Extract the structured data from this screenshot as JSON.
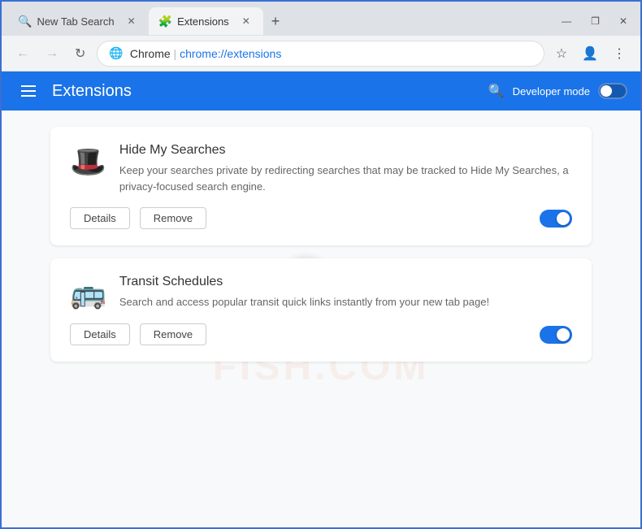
{
  "browser": {
    "tabs": [
      {
        "id": "tab-search",
        "label": "New Tab Search",
        "icon": "🔍",
        "active": false
      },
      {
        "id": "tab-extensions",
        "label": "Extensions",
        "icon": "🧩",
        "active": true
      }
    ],
    "nav": {
      "back_disabled": true,
      "forward_disabled": true
    },
    "address": {
      "brand": "Chrome",
      "url": "chrome://extensions"
    },
    "window_controls": {
      "minimize": "—",
      "maximize": "❐",
      "close": "✕"
    }
  },
  "header": {
    "menu_icon": "☰",
    "title": "Extensions",
    "search_icon": "🔍",
    "developer_mode_label": "Developer mode",
    "developer_mode_on": false
  },
  "extensions": [
    {
      "id": "hide-my-searches",
      "icon": "🎩",
      "name": "Hide My Searches",
      "description": "Keep your searches private by redirecting searches that may be tracked to Hide My Searches, a privacy-focused search engine.",
      "details_label": "Details",
      "remove_label": "Remove",
      "enabled": true
    },
    {
      "id": "transit-schedules",
      "icon": "🚌",
      "name": "Transit Schedules",
      "description": "Search and access popular transit quick links instantly from your new tab page!",
      "details_label": "Details",
      "remove_label": "Remove",
      "enabled": true
    }
  ],
  "watermark": {
    "text": "FISH.COM"
  }
}
